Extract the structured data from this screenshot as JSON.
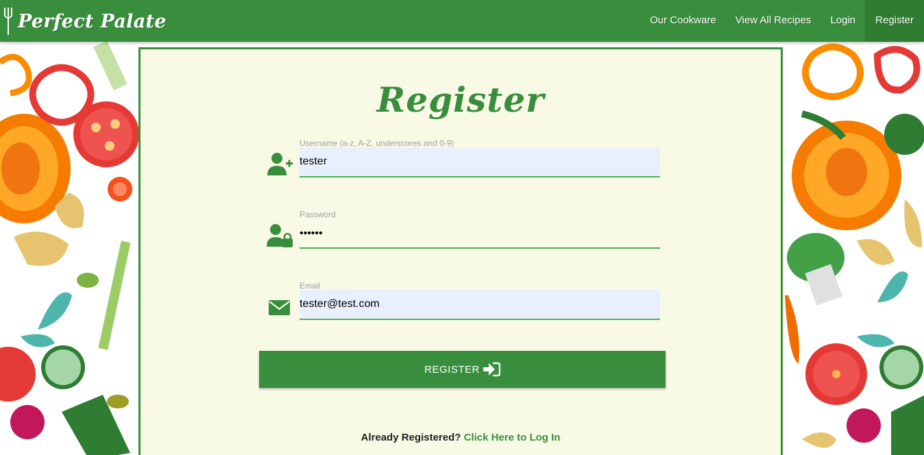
{
  "brand": {
    "name": "Perfect Palate"
  },
  "nav": {
    "items": [
      {
        "label": "Our Cookware"
      },
      {
        "label": "View All Recipes"
      },
      {
        "label": "Login"
      },
      {
        "label": "Register"
      }
    ]
  },
  "form": {
    "title": "Register",
    "username": {
      "label": "Username (a-z, A-Z, underscores and 0-9)",
      "value": "tester"
    },
    "password": {
      "label": "Password",
      "value": "••••••"
    },
    "email": {
      "label": "Email",
      "value": "tester@test.com"
    },
    "submit_label": "REGISTER",
    "footer": {
      "prompt": "Already Registered?",
      "link_label": "Click Here to Log In"
    }
  },
  "colors": {
    "primary": "#388e3c",
    "card_bg": "#f8fae6",
    "input_fill": "#e8f0fe"
  }
}
